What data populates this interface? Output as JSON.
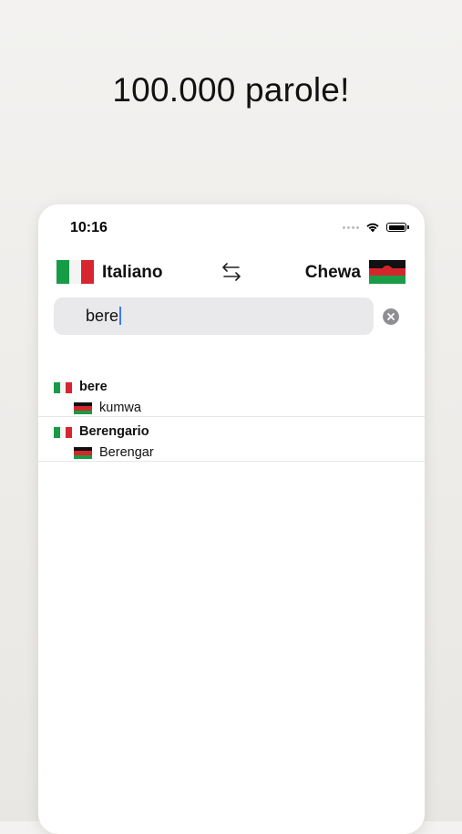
{
  "headline": "100.000 parole!",
  "status_bar": {
    "time": "10:16"
  },
  "language_bar": {
    "source_language": "Italiano",
    "target_language": "Chewa",
    "source_flag": "italy-flag",
    "target_flag": "malawi-flag",
    "swap_icon": "swap-arrows-icon"
  },
  "search": {
    "value": "bere",
    "clear_icon": "clear-circle-icon"
  },
  "results": [
    {
      "word": "bere",
      "translation": "kumwa"
    },
    {
      "word": "Berengario",
      "translation": "Berengar"
    }
  ],
  "colors": {
    "background": "#eeece9",
    "search_fill": "#e9e9eb",
    "caret": "#3b7cf5"
  }
}
